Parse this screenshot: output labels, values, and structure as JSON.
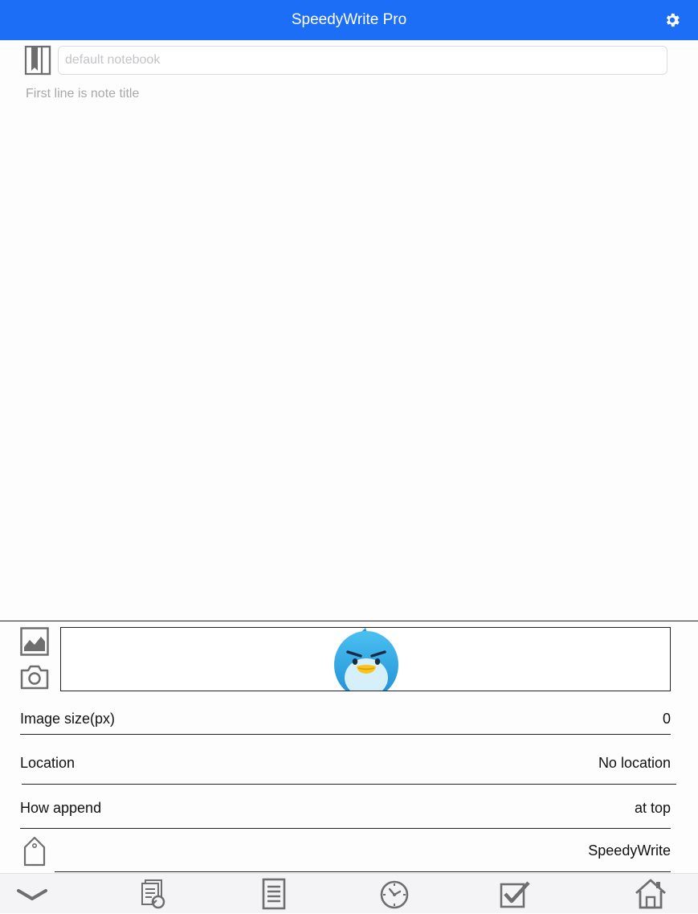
{
  "header": {
    "title": "SpeedyWrite Pro",
    "settings_icon": "gear-icon"
  },
  "notebook": {
    "icon": "notebook-icon",
    "placeholder": "default notebook",
    "value": ""
  },
  "editor": {
    "placeholder": "First line is note title",
    "value": ""
  },
  "attachments": {
    "image_icon": "image-icon",
    "camera_icon": "camera-icon",
    "preview": "penguin-mascot"
  },
  "settings": {
    "image_size_label": "Image size(px)",
    "image_size_value": "0",
    "location_label": "Location",
    "location_value": "No location",
    "how_append_label": "How append",
    "how_append_value": "at top",
    "tag_icon": "tag-icon",
    "tag_value": "SpeedyWrite"
  },
  "tabbar": {
    "items": [
      "chevron-down-icon",
      "history-icon",
      "document-icon",
      "clock-icon",
      "checkbox-icon",
      "home-icon"
    ]
  },
  "colors": {
    "accent": "#1d6ef7",
    "icon_gray": "#6e6e6e"
  }
}
